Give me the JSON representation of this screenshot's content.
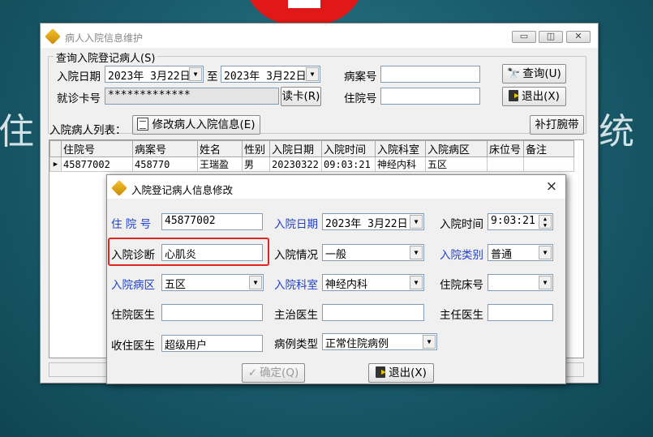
{
  "background": {
    "word_left": "住",
    "word_right": "统"
  },
  "main_window": {
    "title": "病人入院信息维护",
    "controls": {
      "minimize": "▭",
      "maximize": "◫",
      "close": "✕"
    },
    "query_group": {
      "legend": "查询入院登记病人(S)",
      "date_label": "入院日期",
      "date_from": "2023年 3月22日",
      "to_label": "至",
      "date_to": "2023年 3月22日",
      "case_no_label": "病案号",
      "case_no_value": "",
      "card_label": "就诊卡号",
      "card_value": "*************",
      "read_card_button": "读卡(R)",
      "inpatient_no_label": "住院号",
      "inpatient_no_value": "",
      "query_button": "查询(U)",
      "exit_button": "退出(X)"
    },
    "list_label": "入院病人列表：",
    "edit_button": "修改病人入院信息(E)",
    "wristband_button": "补打腕带",
    "table": {
      "headers": [
        "住院号",
        "病案号",
        "姓名",
        "性别",
        "入院日期",
        "入院时间",
        "入院科室",
        "入院病区",
        "床位号",
        "备注"
      ],
      "rows": [
        [
          "45877002",
          "458770",
          "王瑞盈",
          "男",
          "20230322",
          "09:03:21",
          "神经内科",
          "五区",
          "",
          ""
        ]
      ],
      "row_indicator": "▶"
    }
  },
  "dialog": {
    "title": "入院登记病人信息修改",
    "close": "×",
    "fields": {
      "inpatient_no_label": "住 院 号",
      "inpatient_no_value": "45877002",
      "admit_date_label": "入院日期",
      "admit_date_value": "2023年 3月22日",
      "admit_time_label": "入院时间",
      "admit_time_value": "9:03:21",
      "diagnosis_label": "入院诊断",
      "diagnosis_value": "心肌炎",
      "condition_label": "入院情况",
      "condition_value": "一般",
      "category_label": "入院类别",
      "category_value": "普通",
      "ward_label": "入院病区",
      "ward_value": "五区",
      "dept_label": "入院科室",
      "dept_value": "神经内科",
      "bed_label": "住院床号",
      "bed_value": "",
      "resident_label": "住院医生",
      "resident_value": "",
      "attending_label": "主治医生",
      "attending_value": "",
      "chief_label": "主任医生",
      "chief_value": "",
      "admitting_label": "收住医生",
      "admitting_value": "超级用户",
      "case_type_label": "病例类型",
      "case_type_value": "正常住院病例"
    },
    "ok_button": "确定(Q)",
    "exit_button": "退出(X)"
  },
  "colors": {
    "label_blue": "#1f3fc8",
    "highlight": "#e0261f"
  }
}
